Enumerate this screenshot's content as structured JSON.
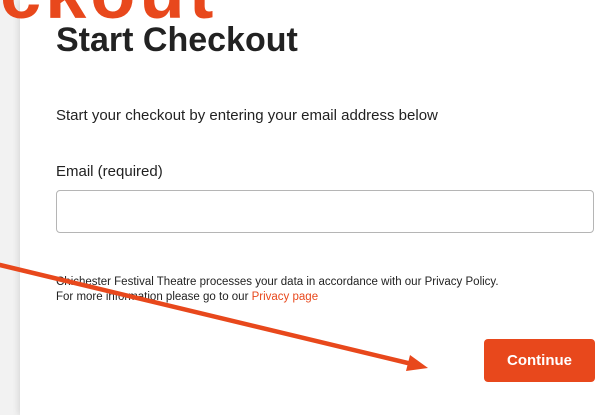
{
  "page": {
    "title": "Start Checkout",
    "intro": "Start your checkout by entering your email address below",
    "background_heading_fragment": "ckout"
  },
  "email": {
    "label": "Email (required)",
    "value": "",
    "placeholder": ""
  },
  "privacy": {
    "line1": "Chichester Festival Theatre processes your data in accordance with our Privacy Policy.",
    "line2_prefix": "For more information please go to our",
    "link_text": "Privacy page"
  },
  "actions": {
    "continue_label": "Continue"
  },
  "annotation": {
    "type": "arrow",
    "color": "#e8481c"
  },
  "colors": {
    "accent": "#e8481c",
    "text": "#222222",
    "input_border": "#b5b5b5"
  }
}
